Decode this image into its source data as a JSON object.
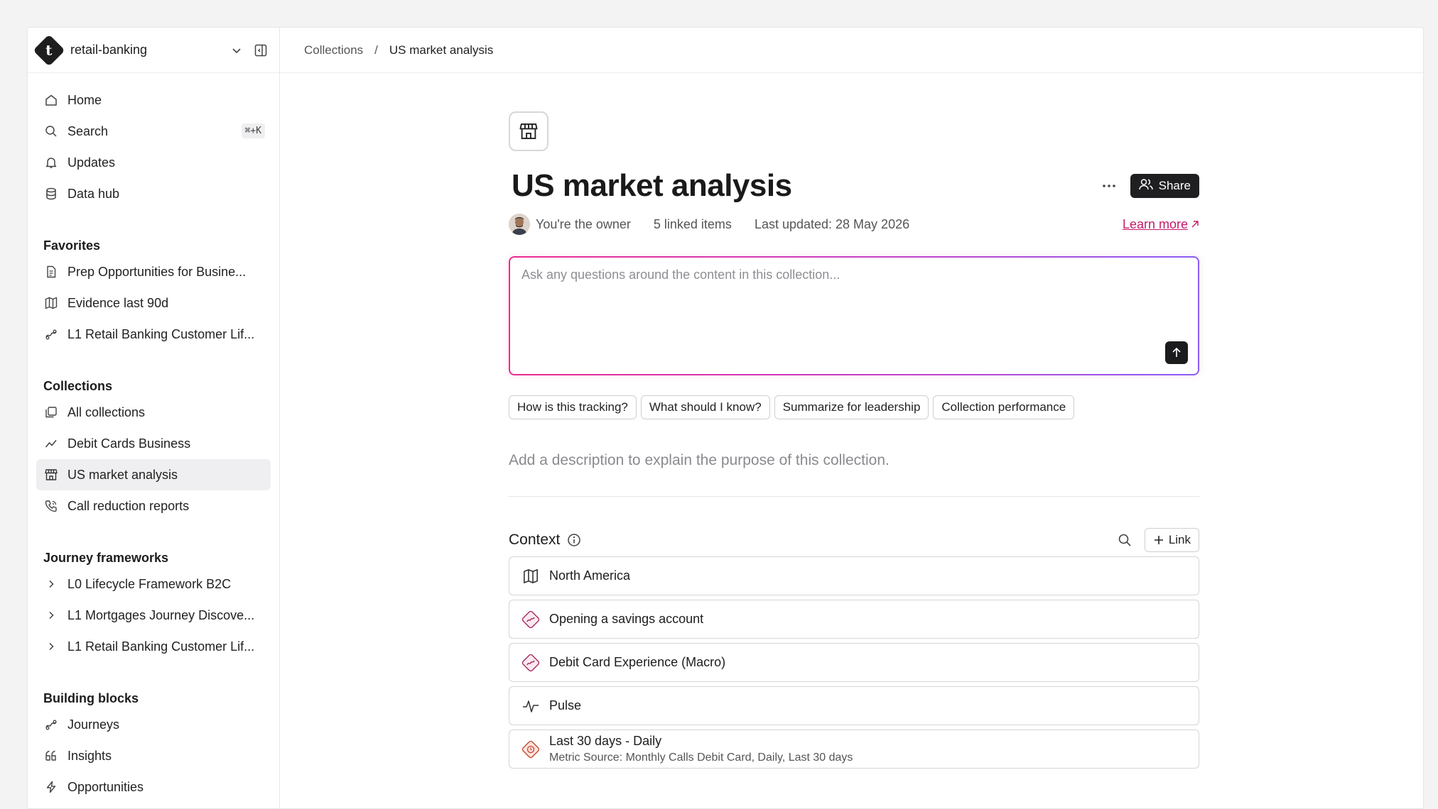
{
  "workspace": {
    "name": "retail-banking",
    "logo_letter": "t"
  },
  "nav": {
    "home": "Home",
    "search": "Search",
    "search_shortcut": "⌘+K",
    "updates": "Updates",
    "data_hub": "Data hub"
  },
  "favorites": {
    "title": "Favorites",
    "items": [
      "Prep Opportunities for Busine...",
      "Evidence last 90d",
      "L1 Retail Banking Customer Lif..."
    ]
  },
  "collections": {
    "title": "Collections",
    "items": [
      "All collections",
      "Debit Cards Business",
      "US market analysis",
      "Call reduction reports"
    ]
  },
  "journeys": {
    "title": "Journey frameworks",
    "items": [
      "L0 Lifecycle Framework B2C",
      "L1 Mortgages Journey Discove...",
      "L1 Retail Banking Customer Lif..."
    ]
  },
  "blocks": {
    "title": "Building blocks",
    "items": [
      "Journeys",
      "Insights",
      "Opportunities"
    ]
  },
  "breadcrumb": {
    "parent": "Collections",
    "separator": "/",
    "current": "US market analysis"
  },
  "page": {
    "title": "US market analysis",
    "share": "Share",
    "owner": "You're the owner",
    "linked": "5 linked items",
    "updated": "Last updated: 28 May 2026",
    "learn_more": "Learn more",
    "ask_placeholder": "Ask any questions around the content in this collection...",
    "chips": [
      "How is this tracking?",
      "What should I know?",
      "Summarize for leadership",
      "Collection performance"
    ],
    "description_placeholder": "Add a description to explain the purpose of this collection."
  },
  "context": {
    "title": "Context",
    "link_label": "Link",
    "items": [
      {
        "title": "North America",
        "icon": "map-icon"
      },
      {
        "title": "Opening a savings account",
        "icon": "journey-badge-icon"
      },
      {
        "title": "Debit Card Experience (Macro)",
        "icon": "journey-badge-icon"
      },
      {
        "title": "Pulse",
        "icon": "pulse-icon"
      },
      {
        "title": "Last 30 days - Daily",
        "subtitle": "Metric Source: Monthly Calls Debit Card, Daily, Last 30 days",
        "icon": "metric-badge-icon"
      }
    ]
  },
  "colors": {
    "accent": "#c41a6a",
    "dark": "#1f1f21"
  }
}
